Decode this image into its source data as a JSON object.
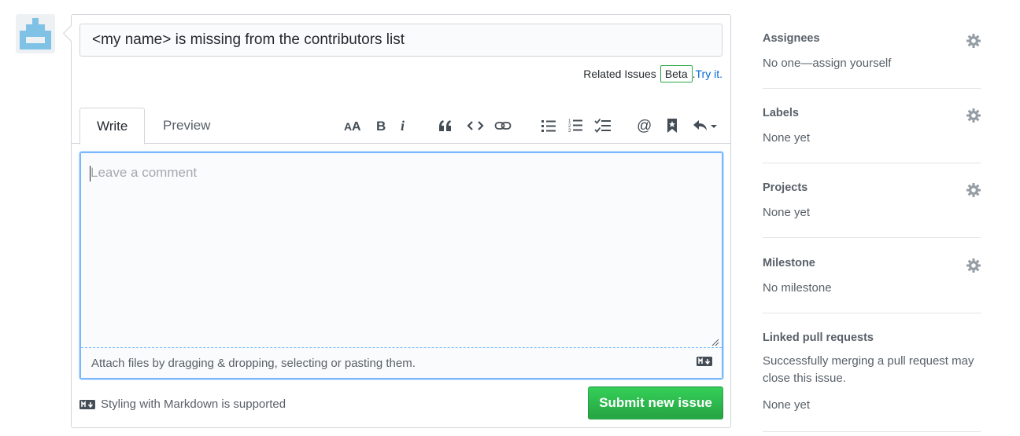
{
  "issue": {
    "title_value": "<my name> is missing from the contributors list",
    "related_issues_label": "Related Issues",
    "beta_badge": "Beta",
    "period": ".",
    "try_link": "Try it."
  },
  "editor": {
    "tabs": [
      {
        "label": "Write",
        "active": true
      },
      {
        "label": "Preview",
        "active": false
      }
    ],
    "toolbar_icons": [
      "text-size-icon",
      "bold-icon",
      "italic-icon",
      "quote-icon",
      "code-icon",
      "link-icon",
      "unordered-list-icon",
      "ordered-list-icon",
      "task-list-icon",
      "mention-icon",
      "bookmark-icon",
      "reply-icon"
    ],
    "comment_placeholder": "Leave a comment",
    "attach_text": "Attach files by dragging & dropping, selecting or pasting them.",
    "markdown_note": "Styling with Markdown is supported",
    "submit_label": "Submit new issue"
  },
  "sidebar": {
    "assignees": {
      "title": "Assignees",
      "value": "No one—assign yourself"
    },
    "labels": {
      "title": "Labels",
      "value": "None yet"
    },
    "projects": {
      "title": "Projects",
      "value": "None yet"
    },
    "milestone": {
      "title": "Milestone",
      "value": "No milestone"
    },
    "linked_prs": {
      "title": "Linked pull requests",
      "description": "Successfully merging a pull request may close this issue.",
      "value": "None yet"
    }
  },
  "colors": {
    "accent_blue": "#0366d6",
    "submit_green": "#28a745",
    "border": "#d1d5da",
    "focus": "#79b8ff"
  }
}
